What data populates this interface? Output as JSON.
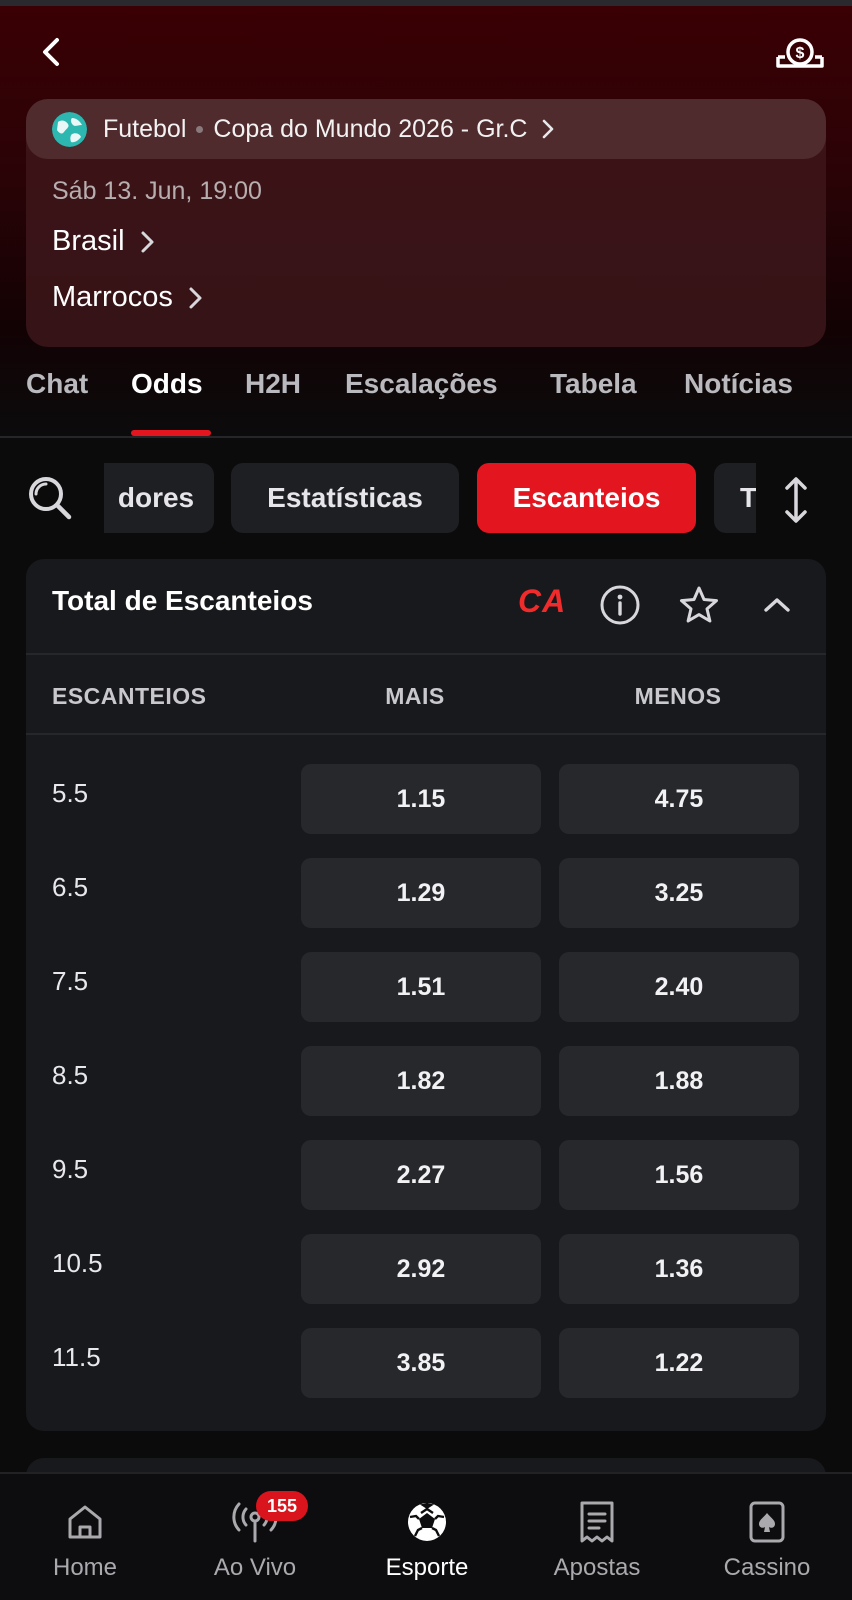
{
  "header": {
    "back_icon": "chevron-left-icon",
    "cashout_icon": "cash-out-icon"
  },
  "event": {
    "sport": "Futebol",
    "competition": "Copa do Mundo 2026 - Gr.C",
    "datetime": "Sáb 13. Jun, 19:00",
    "home_team": "Brasil",
    "away_team": "Marrocos"
  },
  "tabs": [
    {
      "label": "Chat"
    },
    {
      "label": "Odds",
      "active": true
    },
    {
      "label": "H2H"
    },
    {
      "label": "Escalações"
    },
    {
      "label": "Tabela"
    },
    {
      "label": "Notícias"
    }
  ],
  "categories": [
    {
      "label": "dores"
    },
    {
      "label": "Estatísticas"
    },
    {
      "label": "Escanteios",
      "active": true
    },
    {
      "label": "T"
    }
  ],
  "market": {
    "title": "Total de Escanteios",
    "badge": "CA",
    "columns": {
      "line": "ESCANTEIOS",
      "over": "MAIS",
      "under": "MENOS"
    },
    "rows": [
      {
        "line": "5.5",
        "over": "1.15",
        "under": "4.75"
      },
      {
        "line": "6.5",
        "over": "1.29",
        "under": "3.25"
      },
      {
        "line": "7.5",
        "over": "1.51",
        "under": "2.40"
      },
      {
        "line": "8.5",
        "over": "1.82",
        "under": "1.88"
      },
      {
        "line": "9.5",
        "over": "2.27",
        "under": "1.56"
      },
      {
        "line": "10.5",
        "over": "2.92",
        "under": "1.36"
      },
      {
        "line": "11.5",
        "over": "3.85",
        "under": "1.22"
      }
    ]
  },
  "bottom_nav": [
    {
      "label": "Home",
      "icon": "home-icon"
    },
    {
      "label": "Ao Vivo",
      "icon": "live-broadcast-icon",
      "badge": "155"
    },
    {
      "label": "Esporte",
      "icon": "soccer-ball-icon",
      "active": true
    },
    {
      "label": "Apostas",
      "icon": "bet-slip-icon"
    },
    {
      "label": "Cassino",
      "icon": "card-spade-icon"
    }
  ],
  "colors": {
    "accent": "#e3161f",
    "background": "#0b0b0c",
    "card": "#18191c",
    "odd_button": "#27282c"
  }
}
